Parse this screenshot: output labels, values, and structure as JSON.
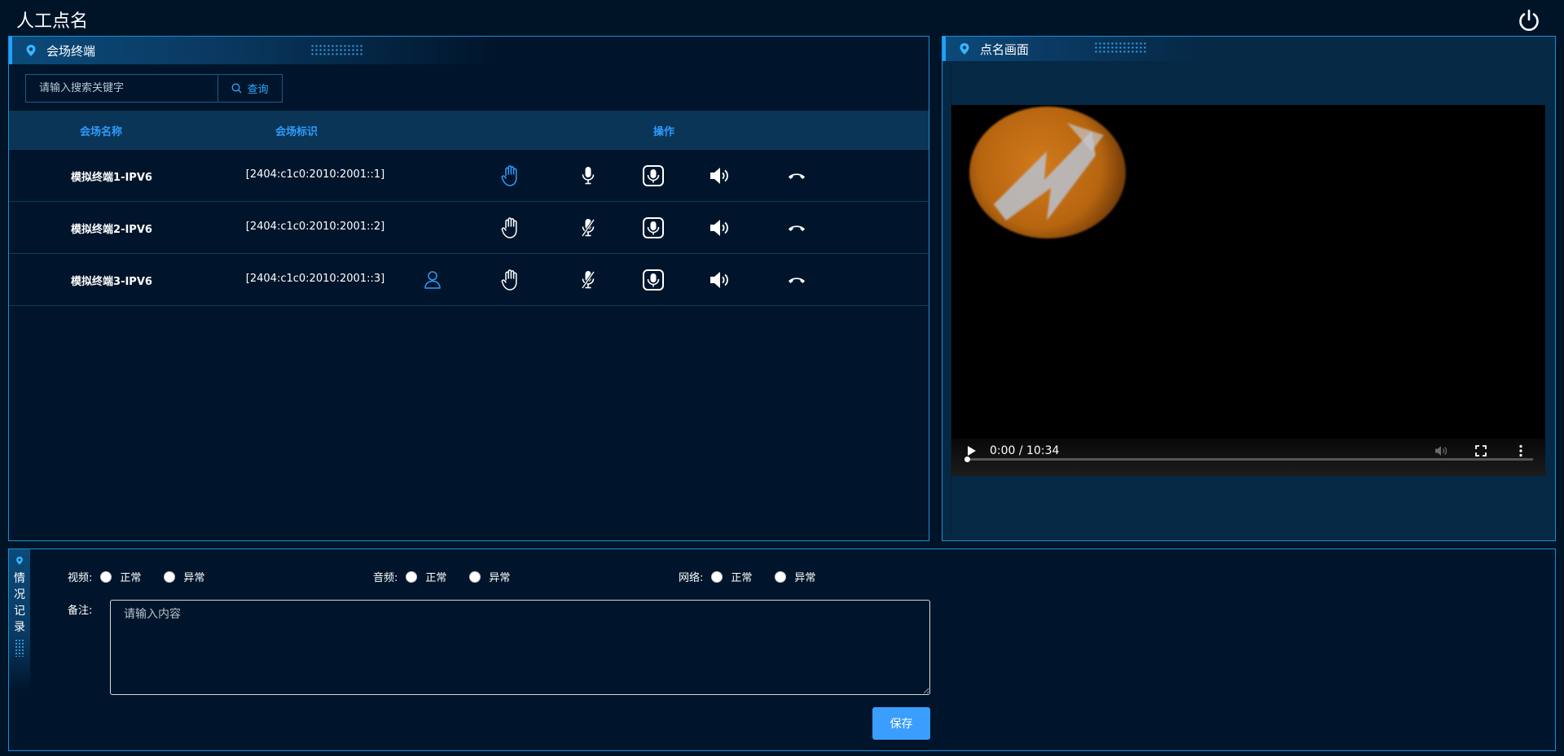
{
  "app": {
    "title": "人工点名"
  },
  "terminals_panel": {
    "title": "会场终端",
    "search": {
      "placeholder": "请输入搜索关键字",
      "button_label": "查询"
    },
    "columns": {
      "name": "会场名称",
      "id": "会场标识",
      "ops": "操作"
    },
    "rows": [
      {
        "name": "模拟终端1-IPV6",
        "id": "[2404:c1c0:2010:2001::1]",
        "has_user": false,
        "hand_active": true,
        "mic_muted": false
      },
      {
        "name": "模拟终端2-IPV6",
        "id": "[2404:c1c0:2010:2001::2]",
        "has_user": false,
        "hand_active": false,
        "mic_muted": true
      },
      {
        "name": "模拟终端3-IPV6",
        "id": "[2404:c1c0:2010:2001::3]",
        "has_user": true,
        "hand_active": false,
        "mic_muted": true
      }
    ]
  },
  "video_panel": {
    "title": "点名画面",
    "player": {
      "time": "0:00 / 10:34",
      "progress": 0.0
    }
  },
  "record_panel": {
    "title": "情况记录",
    "groups": [
      {
        "label": "视频:",
        "options": [
          "正常",
          "异常"
        ]
      },
      {
        "label": "音频:",
        "options": [
          "正常",
          "异常"
        ]
      },
      {
        "label": "网络:",
        "options": [
          "正常",
          "异常"
        ]
      }
    ],
    "remark_label": "备注:",
    "remark_placeholder": "请输入内容",
    "save_label": "保存"
  },
  "colors": {
    "accent": "#2e9bff",
    "border": "#1a8fd6",
    "background": "#001428",
    "button": "#3a9eff"
  }
}
